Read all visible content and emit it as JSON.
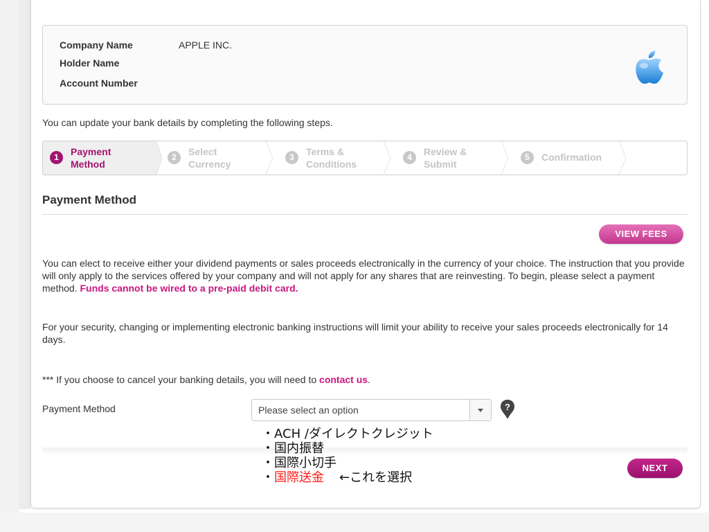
{
  "account": {
    "company_label": "Company Name",
    "company_value": "APPLE INC.",
    "holder_label": "Holder Name",
    "holder_value": "",
    "account_label": "Account Number",
    "account_value": ""
  },
  "intro_text": "You can update your bank details by completing the following steps.",
  "steps": [
    {
      "num": "1",
      "line1": "Payment",
      "line2": "Method",
      "active": true
    },
    {
      "num": "2",
      "line1": "Select",
      "line2": "Currency",
      "active": false
    },
    {
      "num": "3",
      "line1": "Terms &",
      "line2": "Conditions",
      "active": false
    },
    {
      "num": "4",
      "line1": "Review &",
      "line2": "Submit",
      "active": false
    },
    {
      "num": "5",
      "line1": "Confirmation",
      "line2": "",
      "active": false
    }
  ],
  "section_title": "Payment Method",
  "view_fees_label": "VIEW FEES",
  "paragraph1": "You can elect to receive either your dividend payments or sales proceeds electronically in the currency of your choice. The instruction that you provide will only apply to the services offered by your company and will not apply for any shares that are reinvesting. To begin, please select a payment method. ",
  "paragraph1_highlight": "Funds cannot be wired to a pre-paid debit card.",
  "paragraph2": "For your security, changing or implementing electronic banking instructions will limit your ability to receive your sales proceeds electronically for 14 days.",
  "cancel_prefix": "*** If you choose to cancel your banking details, you will need to ",
  "cancel_link": "contact us",
  "cancel_suffix": ".",
  "payment_method_label": "Payment Method",
  "select_placeholder": "Please select an option",
  "options": [
    {
      "bullet": "・",
      "text": "ACH /ダイレクトクレジット"
    },
    {
      "bullet": "・",
      "text": "国内振替"
    },
    {
      "bullet": "・",
      "text": "国際小切手"
    },
    {
      "bullet": "・",
      "text": "国際送金",
      "note": "←これを選択"
    }
  ],
  "next_label": "NEXT",
  "colors": {
    "brand_magenta": "#a3136f",
    "link_pink": "#c8177f",
    "button_pink": "#d852a6",
    "annotation_red": "#ff1a1a"
  },
  "icons": [
    "apple-logo-icon",
    "question-help-icon",
    "chevron-down-icon"
  ]
}
